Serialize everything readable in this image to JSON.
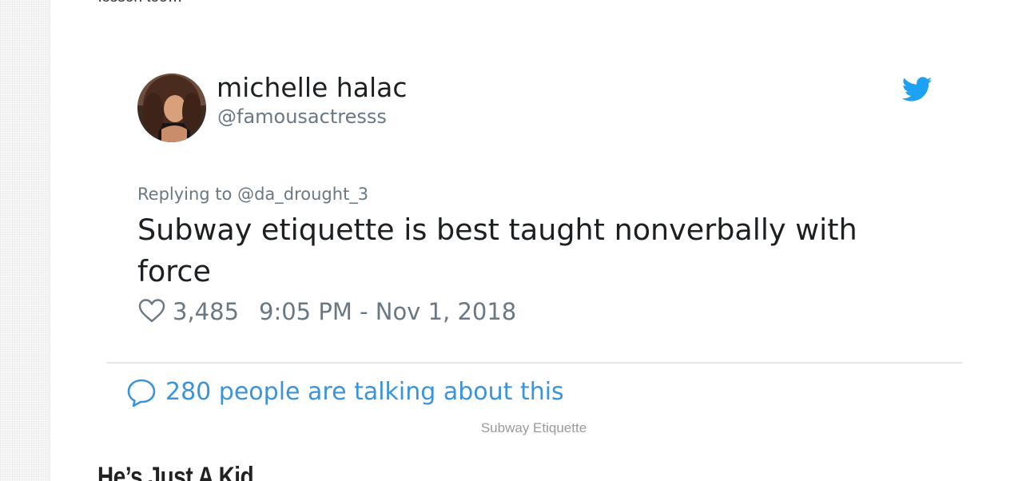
{
  "article": {
    "clipped_text": "lesson too…",
    "image_caption": "Subway Etiquette",
    "next_heading": "He’s Just A Kid"
  },
  "tweet": {
    "author_name": "michelle halac",
    "author_handle": "@famousactresss",
    "reply_to": "Replying to @da_drought_3",
    "text": "Subway etiquette is best taught nonverbally with force",
    "likes": "3,485",
    "timestamp": "9:05 PM - Nov 1, 2018",
    "conversation": "280 people are talking about this"
  },
  "icons": {
    "brand": "twitter-bird-icon",
    "like": "heart-icon",
    "conversation": "speech-bubble-icon"
  },
  "colors": {
    "twitter_blue": "#1da1f2",
    "link_blue": "#3b94d9",
    "text_primary": "#1c2022",
    "text_secondary": "#697882",
    "divider": "#e1e8ed"
  }
}
